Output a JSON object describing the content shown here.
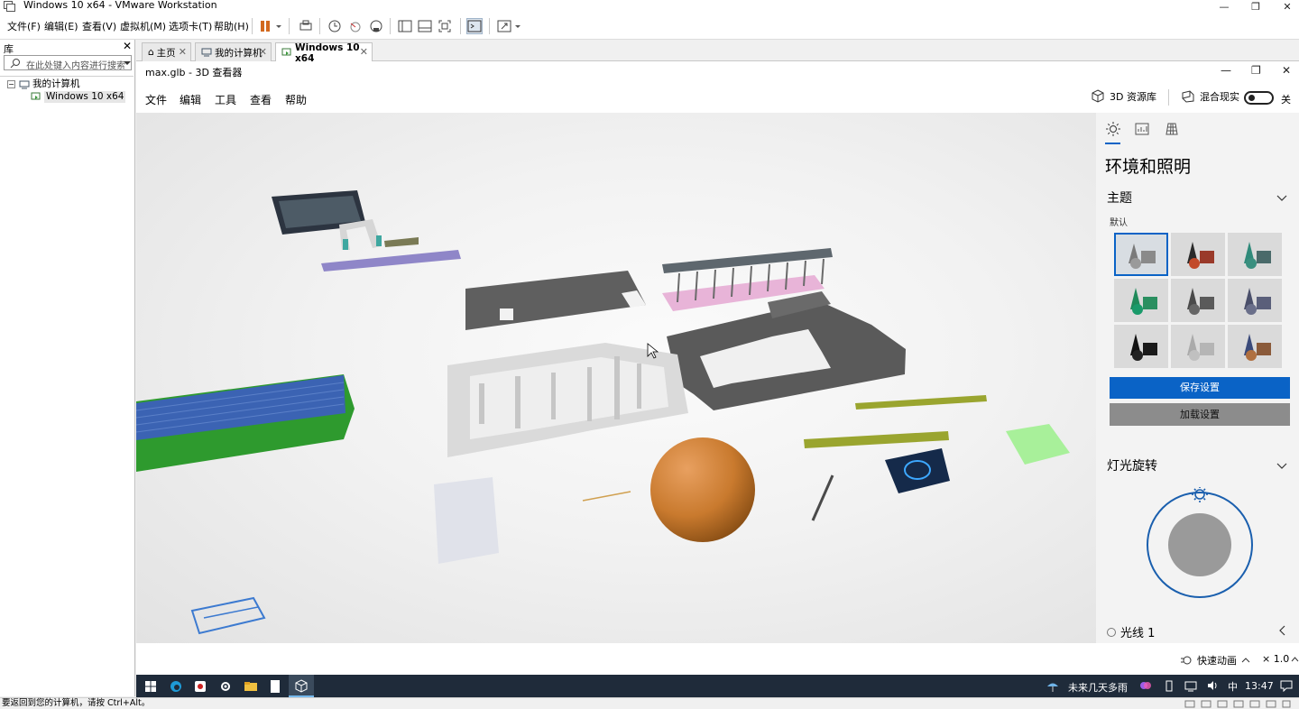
{
  "vmware": {
    "window_title": "Windows 10 x64 - VMware Workstation",
    "menu": [
      "文件(F)",
      "编辑(E)",
      "查看(V)",
      "虚拟机(M)",
      "选项卡(T)",
      "帮助(H)"
    ]
  },
  "library": {
    "header": "库",
    "search_placeholder": "在此处键入内容进行搜索",
    "root": "我的计算机",
    "child": "Windows 10 x64"
  },
  "tabs": [
    {
      "label": "主页",
      "icon": "home-icon"
    },
    {
      "label": "我的计算机",
      "icon": "computer-icon"
    },
    {
      "label": "Windows 10 x64",
      "icon": "vm-icon",
      "active": true
    }
  ],
  "viewer": {
    "title": "max.glb - 3D 查看器",
    "menu": [
      "文件",
      "编辑",
      "工具",
      "查看",
      "帮助"
    ],
    "library_button": "3D 资源库",
    "mixed_reality_label": "混合现实",
    "toggle_state": "关"
  },
  "panel": {
    "heading": "环境和照明",
    "theme_title": "主题",
    "theme_default": "默认",
    "save_button": "保存设置",
    "load_button": "加载设置",
    "light_rotation": "灯光旋转",
    "light1": "光线 1"
  },
  "statusbar": {
    "quick_anim": "快速动画",
    "speed": "× 1.0"
  },
  "taskbar": {
    "weather": "未来几天多雨",
    "time": "13:47"
  },
  "vm_status_text": "要返回到您的计算机，请按 Ctrl+Alt。"
}
